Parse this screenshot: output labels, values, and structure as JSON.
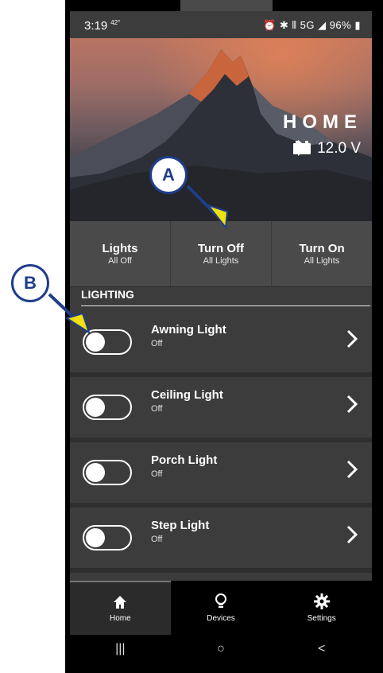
{
  "status_bar": {
    "time": "3:19",
    "temp": "42°",
    "indicators": "⏰ ✱ ⫴ 5G ◢ ",
    "battery": "96%"
  },
  "header": {
    "title": "HOME",
    "voltage": "12.0 V"
  },
  "actions": [
    {
      "label": "Lights",
      "sub": "All Off"
    },
    {
      "label": "Turn Off",
      "sub": "All Lights"
    },
    {
      "label": "Turn On",
      "sub": "All Lights"
    }
  ],
  "lighting": {
    "section_title": "LIGHTING",
    "items": [
      {
        "name": "Awning Light",
        "state": "Off"
      },
      {
        "name": "Ceiling Light",
        "state": "Off"
      },
      {
        "name": "Porch Light",
        "state": "Off"
      },
      {
        "name": "Step Light",
        "state": "Off"
      }
    ]
  },
  "bottom_nav": [
    {
      "label": "Home",
      "icon": "home-icon"
    },
    {
      "label": "Devices",
      "icon": "bulb-icon"
    },
    {
      "label": "Settings",
      "icon": "gear-icon"
    }
  ],
  "system_nav": [
    "|||",
    "○",
    "<"
  ],
  "callouts": [
    "A",
    "B"
  ],
  "colors": {
    "callout_border": "#1f3e8a",
    "arrow_fill": "#f0e10a",
    "arrow_stroke": "#1f3e8a"
  }
}
